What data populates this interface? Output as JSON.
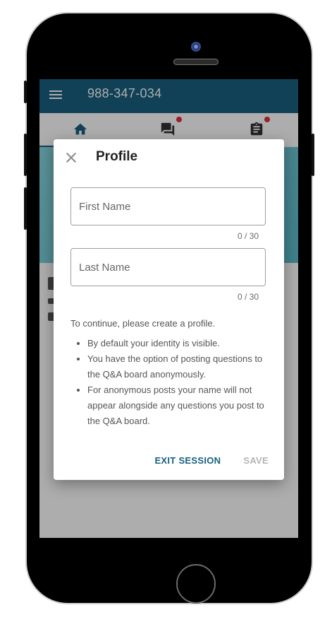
{
  "app": {
    "phone_number": "988-347-034"
  },
  "tabs": [
    {
      "name": "home",
      "icon": "home-icon",
      "has_notification": false
    },
    {
      "name": "qa",
      "icon": "forum-icon",
      "has_notification": true
    },
    {
      "name": "clipboard",
      "icon": "clipboard-icon",
      "has_notification": true
    }
  ],
  "dialog": {
    "title": "Profile",
    "first_name": {
      "placeholder": "First Name",
      "value": "",
      "counter": "0 / 30"
    },
    "last_name": {
      "placeholder": "Last Name",
      "value": "",
      "counter": "0 / 30"
    },
    "intro": "To continue, please create a profile.",
    "bullets": [
      "By default your identity is visible.",
      "You have the option of posting questions to the Q&A board anonymously.",
      "For anonymous posts your name will not appear alongside any questions you post to the Q&A board."
    ],
    "exit_label": "EXIT SESSION",
    "save_label": "SAVE"
  },
  "colors": {
    "primary": "#18607f",
    "notification": "#e0303a",
    "disabled": "#b5b5b5"
  }
}
